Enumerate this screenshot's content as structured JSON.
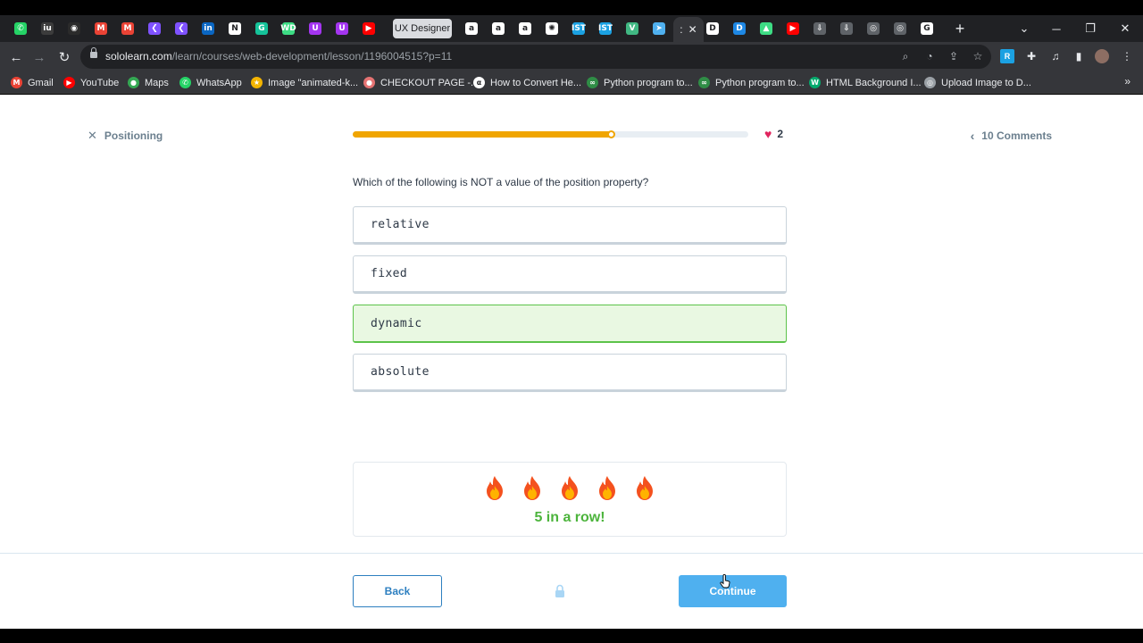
{
  "browser": {
    "tabs": [
      {
        "icon": "whatsapp-icon",
        "color": "#25d366",
        "glyph": "✆"
      },
      {
        "icon": "iu-icon",
        "color": "#3c3c3c",
        "glyph": "iu"
      },
      {
        "icon": "github-icon",
        "color": "#2b2b2b",
        "glyph": "◉"
      },
      {
        "icon": "gmail-icon",
        "color": "#ea4335",
        "glyph": "M"
      },
      {
        "icon": "gmail-icon",
        "color": "#ea4335",
        "glyph": "M"
      },
      {
        "icon": "kotlin-icon",
        "color": "#7f52ff",
        "glyph": "❮"
      },
      {
        "icon": "kotlin-icon",
        "color": "#7f52ff",
        "glyph": "❮"
      },
      {
        "icon": "linkedin-icon",
        "color": "#0a66c2",
        "glyph": "in"
      },
      {
        "icon": "notion-icon",
        "color": "#ffffff",
        "glyph": "N"
      },
      {
        "icon": "grammarly-icon",
        "color": "#15c39a",
        "glyph": "G"
      },
      {
        "icon": "web-icon",
        "color": "#3ddc84",
        "glyph": "WD"
      },
      {
        "icon": "udemy-icon",
        "color": "#a435f0",
        "glyph": "U"
      },
      {
        "icon": "udemy-icon",
        "color": "#a435f0",
        "glyph": "U"
      },
      {
        "icon": "youtube-icon",
        "color": "#ff0000",
        "glyph": "▶"
      }
    ],
    "group_label": "UX Designer",
    "tabs_after_group": [
      {
        "icon": "amazon-icon",
        "color": "#ffffff",
        "glyph": "a"
      },
      {
        "icon": "amazon-icon",
        "color": "#ffffff",
        "glyph": "a"
      },
      {
        "icon": "amazon-icon",
        "color": "#ffffff",
        "glyph": "a"
      },
      {
        "icon": "chatgpt-icon",
        "color": "#ffffff",
        "glyph": "✺"
      },
      {
        "icon": "ist-icon",
        "color": "#1ba1e2",
        "glyph": "IST"
      },
      {
        "icon": "ist-icon",
        "color": "#1ba1e2",
        "glyph": "IST"
      },
      {
        "icon": "vue-icon",
        "color": "#41b883",
        "glyph": "V"
      },
      {
        "icon": "sololearn-icon",
        "color": "#4fb0ef",
        "glyph": "➤"
      }
    ],
    "active_tab_glyph": ":",
    "tabs_after_active": [
      {
        "icon": "dribbble-d-icon",
        "color": "#ffffff",
        "glyph": "D"
      },
      {
        "icon": "d-icon",
        "color": "#1e88e5",
        "glyph": "D"
      },
      {
        "icon": "android-icon",
        "color": "#3ddc84",
        "glyph": "▲"
      },
      {
        "icon": "youtube-icon",
        "color": "#ff0000",
        "glyph": "▶"
      },
      {
        "icon": "download-icon",
        "color": "#5f6368",
        "glyph": "⇩"
      },
      {
        "icon": "download-icon",
        "color": "#5f6368",
        "glyph": "⇩"
      },
      {
        "icon": "globe-icon",
        "color": "#5f6368",
        "glyph": "◎"
      },
      {
        "icon": "globe-icon",
        "color": "#5f6368",
        "glyph": "◎"
      },
      {
        "icon": "google-icon",
        "color": "#ffffff",
        "glyph": "G"
      }
    ],
    "url_host": "sololearn.com",
    "url_path": "/learn/courses/web-development/lesson/1196004515?p=11",
    "bookmarks": [
      {
        "label": "Gmail",
        "icon": "gmail-icon",
        "color": "#ea4335",
        "glyph": "M"
      },
      {
        "label": "YouTube",
        "icon": "youtube-icon",
        "color": "#ff0000",
        "glyph": "▶"
      },
      {
        "label": "Maps",
        "icon": "maps-icon",
        "color": "#34a853",
        "glyph": "●"
      },
      {
        "label": "WhatsApp",
        "icon": "whatsapp-icon",
        "color": "#25d366",
        "glyph": "✆"
      },
      {
        "label": "Image \"animated-k...",
        "icon": "star-icon",
        "color": "#f4b400",
        "glyph": "★"
      },
      {
        "label": "CHECKOUT PAGE -...",
        "icon": "checkout-icon",
        "color": "#e57373",
        "glyph": "●"
      },
      {
        "label": "How to Convert He...",
        "icon": "alpha-icon",
        "color": "#ffffff",
        "glyph": "α"
      },
      {
        "label": "Python program to...",
        "icon": "gfg-icon",
        "color": "#2f8d46",
        "glyph": "∞"
      },
      {
        "label": "Python program to...",
        "icon": "gfg-icon",
        "color": "#2f8d46",
        "glyph": "∞"
      },
      {
        "label": "HTML Background I...",
        "icon": "w3-icon",
        "color": "#04aa6d",
        "glyph": "W"
      },
      {
        "label": "Upload Image to D...",
        "icon": "globe-icon",
        "color": "#9aa0a6",
        "glyph": "◎"
      }
    ]
  },
  "lesson": {
    "back_label": "Positioning",
    "progress": 0.655,
    "hearts": "2",
    "comments_label": "10 Comments",
    "question": "Which of the following is NOT a value of the position property?",
    "options": [
      {
        "label": "relative",
        "selected": false
      },
      {
        "label": "fixed",
        "selected": false
      },
      {
        "label": "dynamic",
        "selected": true
      },
      {
        "label": "absolute",
        "selected": false
      }
    ],
    "streak_count": 5,
    "streak_text": "5 in a row!",
    "back_button": "Back",
    "continue_button": "Continue"
  },
  "colors": {
    "progress": "#f0a500",
    "correct": "#5cc34a",
    "primary": "#4fb0ef",
    "heart": "#e0245e"
  }
}
